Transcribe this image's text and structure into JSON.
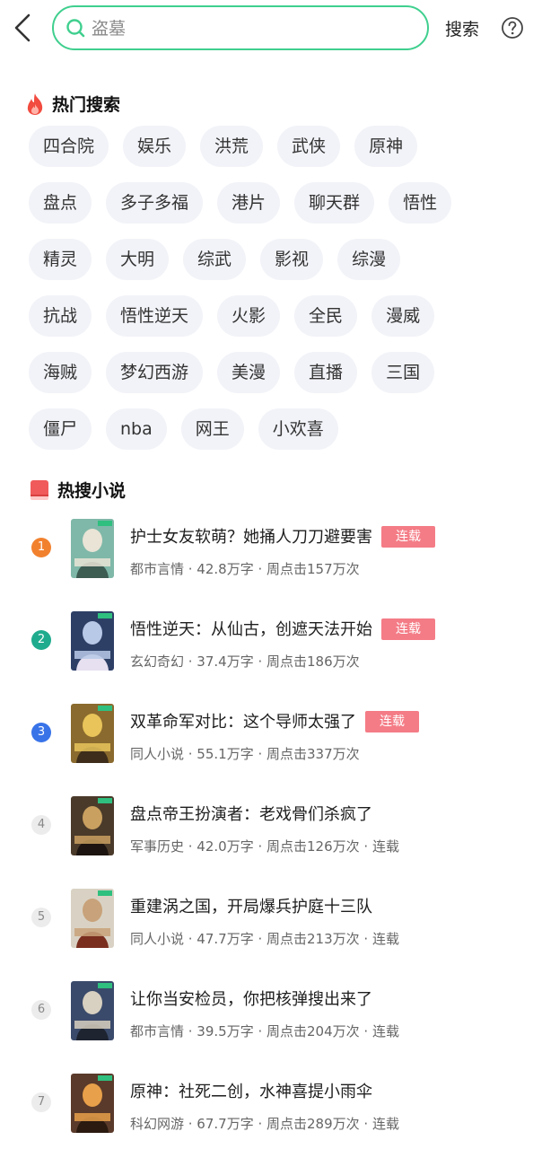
{
  "header": {
    "search_placeholder": "盗墓",
    "search_button": "搜索"
  },
  "hot_search": {
    "title": "热门搜索",
    "rows": [
      [
        "四合院",
        "娱乐",
        "洪荒",
        "武侠",
        "原神"
      ],
      [
        "盘点",
        "多子多福",
        "港片",
        "聊天群",
        "悟性"
      ],
      [
        "精灵",
        "大明",
        "综武",
        "影视",
        "综漫"
      ],
      [
        "抗战",
        "悟性逆天",
        "火影",
        "全民",
        "漫威"
      ],
      [
        "海贼",
        "梦幻西游",
        "美漫",
        "直播",
        "三国"
      ],
      [
        "僵尸",
        "nba",
        "网王",
        "小欢喜"
      ]
    ]
  },
  "hot_novels": {
    "title": "热搜小说",
    "items": [
      {
        "rank": "1",
        "title": "护士女友软萌？她捅人刀刀避要害",
        "badge": "连载",
        "meta": "都市言情 · 42.8万字 · 周点击157万次"
      },
      {
        "rank": "2",
        "title": "悟性逆天：从仙古，创遮天法开始",
        "badge": "连载",
        "meta": "玄幻奇幻 · 37.4万字 · 周点击186万次"
      },
      {
        "rank": "3",
        "title": "双革命军对比：这个导师太强了",
        "badge": "连载",
        "meta": "同人小说 · 55.1万字 · 周点击337万次"
      },
      {
        "rank": "4",
        "title": "盘点帝王扮演者：老戏骨们杀疯了",
        "badge": "",
        "meta": "军事历史 · 42.0万字 · 周点击126万次 · 连载"
      },
      {
        "rank": "5",
        "title": "重建涡之国，开局爆兵护庭十三队",
        "badge": "",
        "meta": "同人小说 · 47.7万字 · 周点击213万次 · 连载"
      },
      {
        "rank": "6",
        "title": "让你当安检员，你把核弹搜出来了",
        "badge": "",
        "meta": "都市言情 · 39.5万字 · 周点击204万次 · 连载"
      },
      {
        "rank": "7",
        "title": "原神：社死二创，水神喜提小雨伞",
        "badge": "",
        "meta": "科幻网游 · 67.7万字 · 周点击289万次 · 连载"
      }
    ]
  }
}
